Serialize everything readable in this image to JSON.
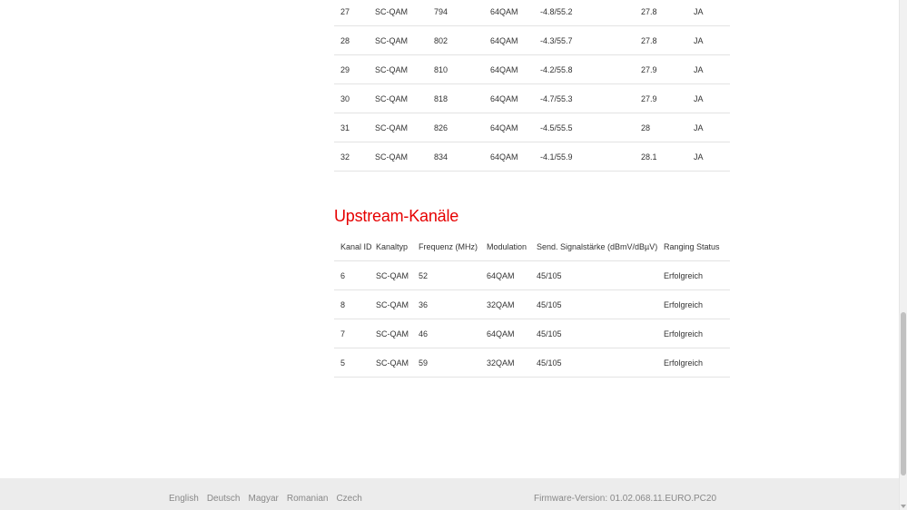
{
  "downstream": {
    "rows": [
      [
        "27",
        "SC-QAM",
        "794",
        "64QAM",
        "-4.8/55.2",
        "27.8",
        "JA"
      ],
      [
        "28",
        "SC-QAM",
        "802",
        "64QAM",
        "-4.3/55.7",
        "27.8",
        "JA"
      ],
      [
        "29",
        "SC-QAM",
        "810",
        "64QAM",
        "-4.2/55.8",
        "27.9",
        "JA"
      ],
      [
        "30",
        "SC-QAM",
        "818",
        "64QAM",
        "-4.7/55.3",
        "27.9",
        "JA"
      ],
      [
        "31",
        "SC-QAM",
        "826",
        "64QAM",
        "-4.5/55.5",
        "28",
        "JA"
      ],
      [
        "32",
        "SC-QAM",
        "834",
        "64QAM",
        "-4.1/55.9",
        "28.1",
        "JA"
      ]
    ]
  },
  "upstream": {
    "title": "Upstream-Kanäle",
    "headers": [
      "Kanal ID",
      "Kanaltyp",
      "Frequenz (MHz)",
      "Modulation",
      "Send. Signalstärke (dBmV/dBµV)",
      "Ranging Status"
    ],
    "rows": [
      [
        "6",
        "SC-QAM",
        "52",
        "64QAM",
        "45/105",
        "Erfolgreich"
      ],
      [
        "8",
        "SC-QAM",
        "36",
        "32QAM",
        "45/105",
        "Erfolgreich"
      ],
      [
        "7",
        "SC-QAM",
        "46",
        "64QAM",
        "45/105",
        "Erfolgreich"
      ],
      [
        "5",
        "SC-QAM",
        "59",
        "32QAM",
        "45/105",
        "Erfolgreich"
      ]
    ]
  },
  "footer": {
    "languages": [
      "English",
      "Deutsch",
      "Magyar",
      "Romanian",
      "Czech"
    ],
    "firmware": "Firmware-Version: 01.02.068.11.EURO.PC20"
  },
  "colors": {
    "accent": "#e60000",
    "footer_bg": "#ececec",
    "text": "#333333",
    "muted": "#888888"
  },
  "scrollbar": {
    "position_fraction": 0.62
  }
}
